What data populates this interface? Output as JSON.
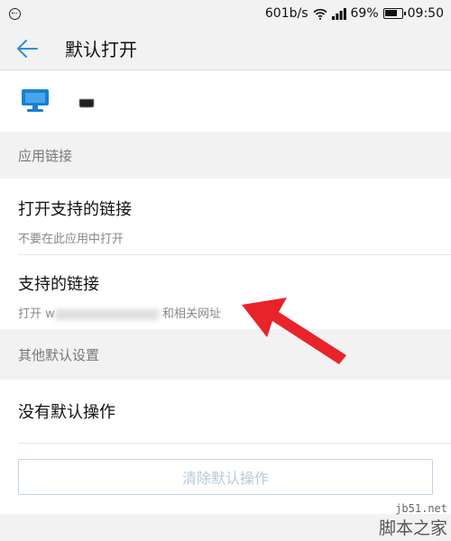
{
  "status_bar": {
    "network_speed": "601b/s",
    "battery": "69%",
    "time": "09:50"
  },
  "header": {
    "title": "默认打开"
  },
  "sections": {
    "links_header": "应用链接",
    "other_header": "其他默认设置"
  },
  "links": {
    "open_supported_title": "打开支持的链接",
    "open_supported_sub": "不要在此应用中打开",
    "supported_title": "支持的链接",
    "supported_sub_prefix": "打开",
    "supported_sub_partial": "w",
    "supported_sub_suffix": "和相关网址"
  },
  "defaults": {
    "no_default_title": "没有默认操作",
    "clear_button_label": "清除默认操作"
  },
  "watermark": {
    "url": "jb51.net",
    "name": "脚本之家"
  },
  "colors": {
    "accent": "#2d8fd6",
    "annotation_arrow": "#e8232a",
    "section_bg": "#f2f2f2"
  }
}
